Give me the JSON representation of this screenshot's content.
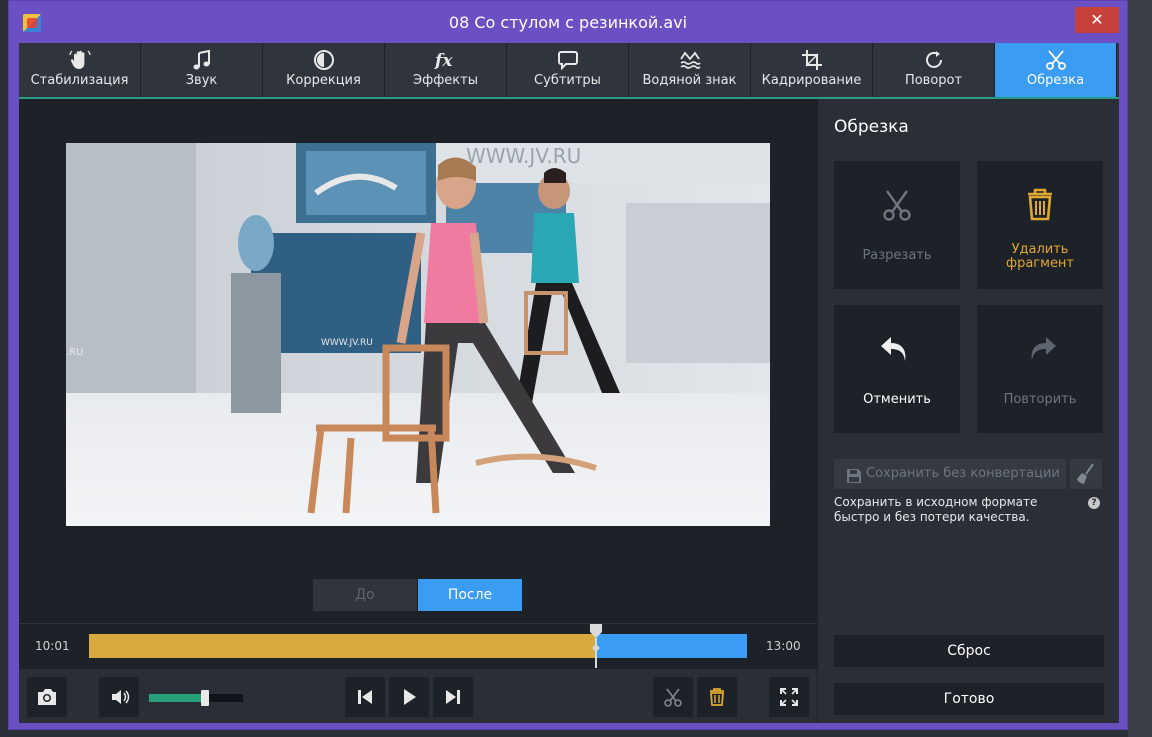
{
  "window": {
    "title": "08 Со стулом с резинкой.avi",
    "close_glyph": "✕"
  },
  "tabs": [
    {
      "label": "Стабилизация",
      "icon": "hand-icon"
    },
    {
      "label": "Звук",
      "icon": "music-note-icon"
    },
    {
      "label": "Коррекция",
      "icon": "contrast-icon"
    },
    {
      "label": "Эффекты",
      "icon": "fx-icon"
    },
    {
      "label": "Субтитры",
      "icon": "speech-bubble-icon"
    },
    {
      "label": "Водяной знак",
      "icon": "watermark-icon"
    },
    {
      "label": "Кадрирование",
      "icon": "crop-icon"
    },
    {
      "label": "Поворот",
      "icon": "rotate-icon"
    },
    {
      "label": "Обрезка",
      "icon": "scissors-icon",
      "active": true
    }
  ],
  "preview": {
    "overlay_texts": {
      "banner": "WWW.JV.RU",
      "wall": "WWW.JV.RU",
      "edge": ".RU"
    },
    "before_label": "До",
    "after_label": "После",
    "selected": "after"
  },
  "timeline": {
    "start": "10:01",
    "end": "13:00",
    "progress": 0.77
  },
  "volume": {
    "level": 0.6
  },
  "panel": {
    "title": "Обрезка",
    "cut_label": "Разрезать",
    "delete_label": "Удалить фрагмент",
    "undo_label": "Отменить",
    "redo_label": "Повторить",
    "save_no_convert_label": "Сохранить без конвертации",
    "save_description": "Сохранить в исходном формате быстро и без потери качества.",
    "help_glyph": "?",
    "reset_label": "Сброс",
    "done_label": "Готово"
  },
  "colors": {
    "accent": "#3a9cf2",
    "trim_fill": "#d7a93e",
    "delete_icon": "#e0a830",
    "titlebar": "#6b50c4",
    "volume": "#27a07a"
  }
}
